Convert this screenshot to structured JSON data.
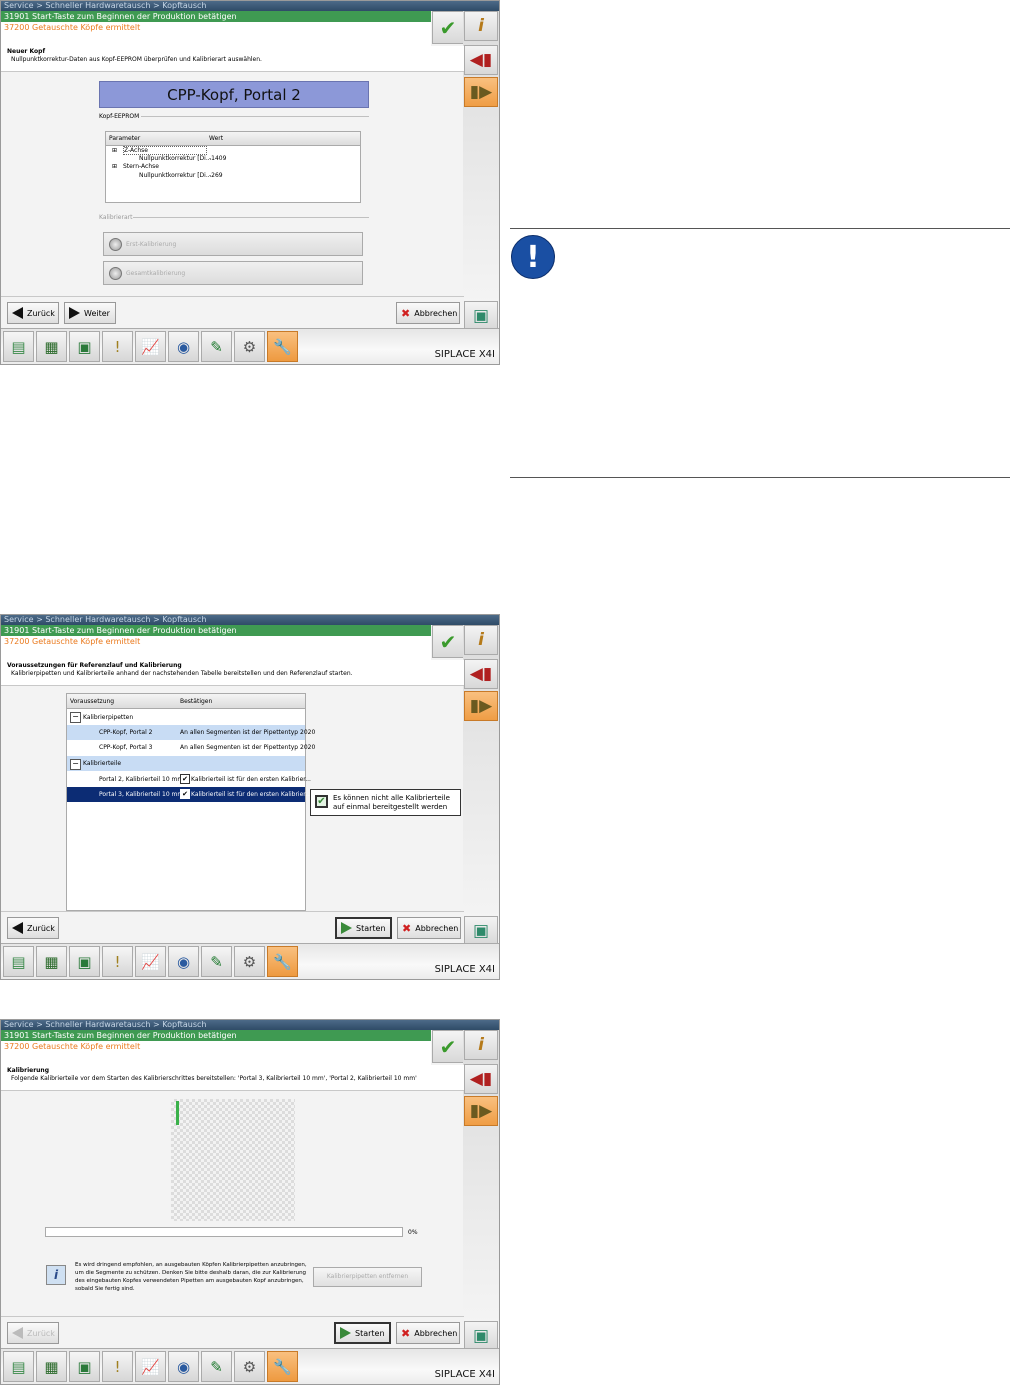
{
  "common": {
    "breadcrumb": "Service > Schneller Hardwaretausch > Kopftausch",
    "status_line1": "31901 Start-Taste zum Beginnen der Produktion betätigen",
    "status_line2": "37200 Getauschte Köpfe ermittelt",
    "brand": "SIPLACE X4I",
    "btn_zurueck": "Zurück",
    "btn_weiter": "Weiter",
    "btn_abbrechen": "Abbrechen",
    "btn_starten": "Starten"
  },
  "screen1": {
    "header_title": "Neuer Kopf",
    "header_desc": "Nullpunktkorrektur-Daten aus Kopf-EEPROM überprüfen und Kalibrierart auswählen.",
    "head_title": "CPP-Kopf, Portal 2",
    "group_label": "Kopf-EEPROM",
    "col_param": "Parameter",
    "col_value": "Wert",
    "row1": "Z-Achse",
    "row2": "Nullpunktkorrektur [Di...",
    "row2_value": "-1409",
    "row3": "Stern-Achse",
    "row4": "Nullpunktkorrektur [Di...",
    "row4_value": "-269",
    "group2_label": "Kalibrierart",
    "radio1": "Erst-Kalibrierung",
    "radio2": "Gesamtkalibrierung"
  },
  "screen2": {
    "header_title": "Voraussetzungen für Referenzlauf und Kalibrierung",
    "header_desc": "Kalibrierpipetten und Kalibrierteile anhand der nachstehenden Tabelle bereitstellen und den Referenzlauf starten.",
    "col1": "Voraussetzung",
    "col2": "Bestätigen",
    "group1": "Kalibrierpipetten",
    "item1": "CPP-Kopf, Portal 2",
    "item1_val": "An allen Segmenten ist der Pipettentyp 2020",
    "item2": "CPP-Kopf, Portal 3",
    "item2_val": "An allen Segmenten ist der Pipettentyp 2020",
    "group2": "Kalibrierteile",
    "item3": "Portal 2, Kalibrierteil 10 mm",
    "item3_val": "Kalibrierteil ist für den ersten Kalibrier...",
    "item4": "Portal 3, Kalibrierteil 10 mm",
    "item4_val": "Kalibrierteil ist für den ersten Kalibrier...",
    "check_text1": "Es können nicht alle Kalibrierteile",
    "check_text2": "auf einmal bereitgestellt werden"
  },
  "screen3": {
    "header_title": "Kalibrierung",
    "header_desc": "Folgende Kalibrierteile vor dem Starten des Kalibrierschrittes bereitstellen: 'Portal 3, Kalibrierteil 10 mm', 'Portal 2, Kalibrierteil 10 mm'",
    "progress": 0,
    "progress_label": "0%",
    "info_text1": "Es wird dringend empfohlen, an ausgebauten Köpfen Kalibrierpipetten anzubringen,",
    "info_text2": "um die Segmente zu schützen. Denken Sie bitte deshalb daran, die zur Kalibrierung",
    "info_text3": "des eingebauten Kopfes verwendeten Pipetten am ausgebauten Kopf anzubringen,",
    "info_text4": "sobald Sie fertig sind.",
    "btn_remove": "Kalibrierpipetten entfernen"
  },
  "icons": [
    "checkmark-icon",
    "info-icon",
    "head-remove-icon",
    "head-install-icon",
    "screen-next-icon",
    "book-icon",
    "grid-icon",
    "board-icon",
    "warning-icon",
    "chart-icon",
    "camera-icon",
    "pen-icon",
    "gears-icon",
    "wrench-icon",
    "exclamation-icon"
  ],
  "colors": {
    "status_green": "#3f9a52",
    "status_orange": "#ea7a1e",
    "head_title_bg": "#8c98d8",
    "selection": "#0c2c74",
    "note_blue": "#1a4fa3"
  }
}
